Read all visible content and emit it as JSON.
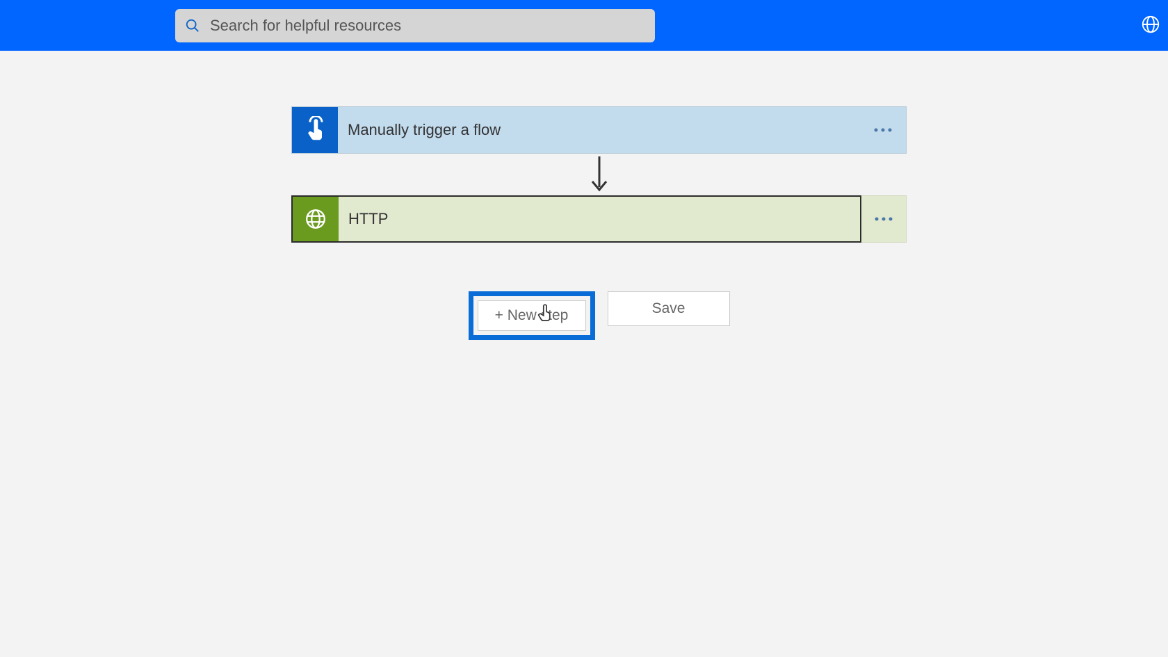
{
  "header": {
    "search_placeholder": "Search for helpful resources"
  },
  "flow": {
    "trigger": {
      "title": "Manually trigger a flow",
      "icon": "tap-icon"
    },
    "steps": [
      {
        "title": "HTTP",
        "icon": "globe-icon"
      }
    ]
  },
  "actions": {
    "new_step_label": "+ New step",
    "save_label": "Save"
  }
}
